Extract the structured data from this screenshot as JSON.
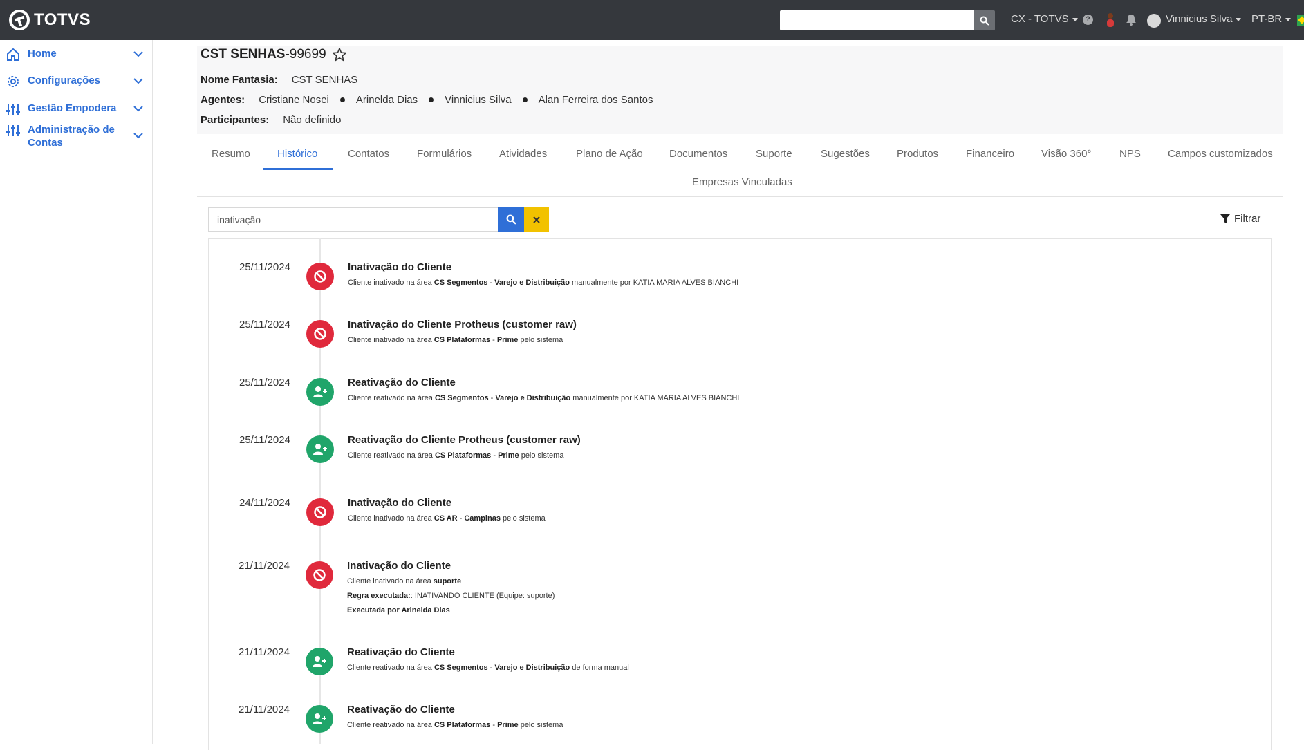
{
  "topbar": {
    "brand": "TOTVS",
    "search_value": "",
    "workspace": "CX - TOTVS",
    "help": "?",
    "user_name": "Vinnicius Silva",
    "language": "PT-BR"
  },
  "sidebar": {
    "items": [
      {
        "label": "Home"
      },
      {
        "label": "Configurações"
      },
      {
        "label": "Gestão Empodera"
      },
      {
        "label": "Administração de Contas"
      }
    ]
  },
  "header": {
    "title_name": "CST SENHAS",
    "title_code": "-99699",
    "fantasy_label": "Nome Fantasia:",
    "fantasy_value": "CST SENHAS",
    "agents_label": "Agentes:",
    "agents": [
      "Cristiane Nosei",
      "Arinelda Dias",
      "Vinnicius Silva",
      "Alan Ferreira dos Santos"
    ],
    "participants_label": "Participantes:",
    "participants_value": "Não definido"
  },
  "tabs": [
    "Resumo",
    "Histórico",
    "Contatos",
    "Formulários",
    "Atividades",
    "Plano de Ação",
    "Documentos",
    "Suporte",
    "Sugestões",
    "Produtos",
    "Financeiro",
    "Visão 360°",
    "NPS",
    "Campos customizados",
    "Empresas Vinculadas"
  ],
  "history_search": {
    "value": "inativação",
    "filter_label": "Filtrar"
  },
  "entries": [
    {
      "date": "25/11/2024",
      "kind": "inactivation",
      "title": "Inativação do Cliente",
      "desc": [
        [
          "Cliente inativado na área ",
          false
        ],
        [
          "CS Segmentos",
          true
        ],
        [
          " - ",
          false
        ],
        [
          "Varejo e Distribuição",
          true
        ],
        [
          " manualmente por KATIA MARIA ALVES BIANCHI",
          false
        ]
      ]
    },
    {
      "date": "25/11/2024",
      "kind": "inactivation",
      "title": "Inativação do Cliente Protheus (customer raw)",
      "desc": [
        [
          "Cliente inativado na área ",
          false
        ],
        [
          "CS Plataformas",
          true
        ],
        [
          " - ",
          false
        ],
        [
          "Prime",
          true
        ],
        [
          " pelo sistema",
          false
        ]
      ]
    },
    {
      "date": "25/11/2024",
      "kind": "reactivation",
      "title": "Reativação do Cliente",
      "desc": [
        [
          "Cliente reativado na área ",
          false
        ],
        [
          "CS Segmentos",
          true
        ],
        [
          " - ",
          false
        ],
        [
          "Varejo e Distribuição",
          true
        ],
        [
          " manualmente por KATIA MARIA ALVES BIANCHI",
          false
        ]
      ]
    },
    {
      "date": "25/11/2024",
      "kind": "reactivation",
      "title": "Reativação do Cliente Protheus (customer raw)",
      "desc": [
        [
          "Cliente reativado na área ",
          false
        ],
        [
          "CS Plataformas",
          true
        ],
        [
          " - ",
          false
        ],
        [
          "Prime",
          true
        ],
        [
          " pelo sistema",
          false
        ]
      ]
    },
    {
      "date": "24/11/2024",
      "kind": "inactivation",
      "title": "Inativação do Cliente",
      "desc": [
        [
          "Cliente inativado na área ",
          false
        ],
        [
          "CS AR",
          true
        ],
        [
          " - ",
          false
        ],
        [
          "Campinas",
          true
        ],
        [
          " pelo sistema",
          false
        ]
      ]
    },
    {
      "date": "21/11/2024",
      "kind": "inactivation",
      "title": "Inativação do Cliente",
      "desc": [
        [
          "Cliente inativado na área ",
          false
        ],
        [
          "suporte",
          true
        ]
      ],
      "desc2": [
        [
          "Regra executada:",
          true
        ],
        [
          ": INATIVANDO CLIENTE (Equipe: suporte)",
          false
        ]
      ],
      "desc3": [
        [
          "Executada por Arinelda Dias",
          true
        ]
      ]
    },
    {
      "date": "21/11/2024",
      "kind": "reactivation",
      "title": "Reativação do Cliente",
      "desc": [
        [
          "Cliente reativado na área ",
          false
        ],
        [
          "CS Segmentos",
          true
        ],
        [
          " - ",
          false
        ],
        [
          "Varejo e Distribuição",
          true
        ],
        [
          " de forma manual",
          false
        ]
      ]
    },
    {
      "date": "21/11/2024",
      "kind": "reactivation",
      "title": "Reativação do Cliente",
      "desc": [
        [
          "Cliente reativado na área ",
          false
        ],
        [
          "CS Plataformas",
          true
        ],
        [
          " - ",
          false
        ],
        [
          "Prime",
          true
        ],
        [
          " pelo sistema",
          false
        ]
      ]
    }
  ],
  "colors": {
    "accent": "#2f6fd7",
    "topbar": "#35383d",
    "inactivation": "#e0293c",
    "reactivation": "#20a56a",
    "clear_button": "#f2c200"
  }
}
